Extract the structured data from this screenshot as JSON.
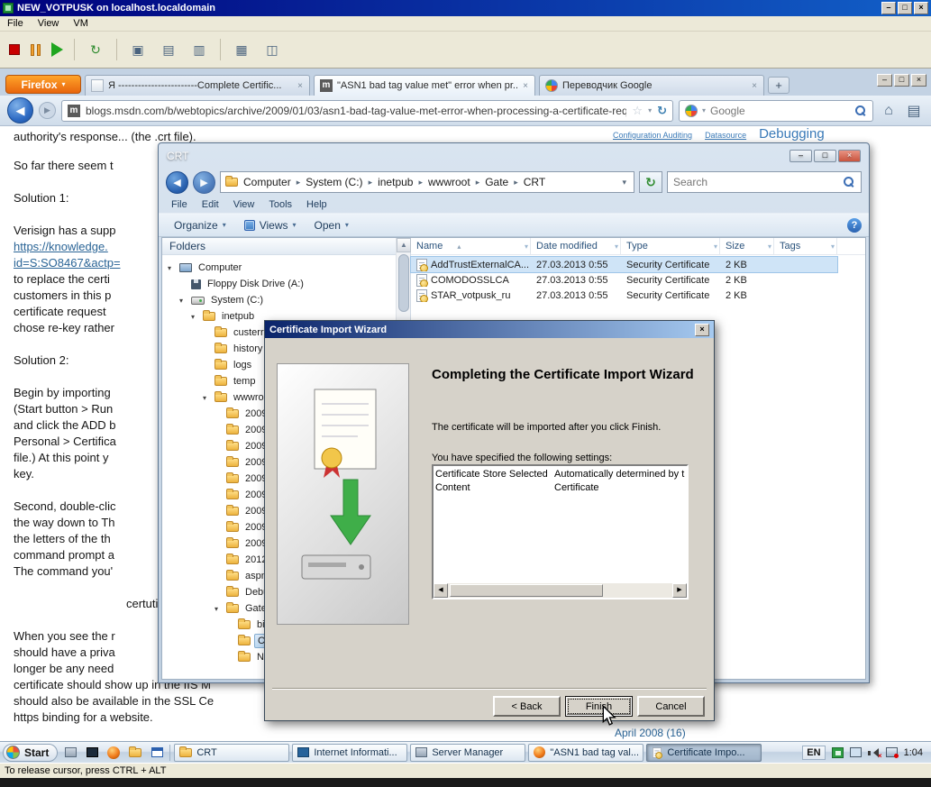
{
  "vm": {
    "title": "NEW_VOTPUSK on localhost.localdomain",
    "menu": [
      "File",
      "View",
      "VM"
    ],
    "status": "To release cursor, press CTRL + ALT"
  },
  "icons": {
    "minimize": "–",
    "maximize": "□",
    "close": "×",
    "back_arrow": "◀",
    "forward_arrow": "▶",
    "dropdown": "▾",
    "reload": "↻",
    "home": "⌂",
    "new_tab": "+"
  },
  "browser": {
    "app_button": "Firefox",
    "tabs": [
      {
        "title": "Я ------------------------Complete Certific...",
        "active": false
      },
      {
        "title": "\"ASN1 bad tag value met\" error when pr...",
        "active": true
      },
      {
        "title": "Переводчик Google",
        "active": false
      }
    ],
    "url": "blogs.msdn.com/b/webtopics/archive/2009/01/03/asn1-bad-tag-value-met-error-when-processing-a-certificate-request-in",
    "search_placeholder": "Google"
  },
  "page": {
    "header_links": [
      "Configuration Auditing",
      "Datasource",
      "Debugging"
    ],
    "paragraphs": [
      {
        "lines": [
          {
            "t": "authority's response...  (the .crt file)."
          }
        ]
      },
      {
        "lines": [
          {
            "t": "So far there seem t"
          }
        ]
      },
      {
        "lines": [
          {
            "t": "Solution 1:"
          }
        ]
      },
      {
        "lines": [
          {
            "t": "Verisign has a supp"
          },
          {
            "t": "https://knowledge.",
            "link": true
          },
          {
            "t": "id=S:SO8467&actp=",
            "link": true
          },
          {
            "t": "to replace the certi"
          },
          {
            "t": "customers in this p"
          },
          {
            "t": "certificate request"
          },
          {
            "t": "chose re-key rather"
          }
        ]
      },
      {
        "lines": [
          {
            "t": "Solution 2:"
          }
        ]
      },
      {
        "lines": [
          {
            "t": "Begin by importing"
          },
          {
            "t": "(Start button > Run"
          },
          {
            "t": "and click the ADD b"
          },
          {
            "t": "Personal > Certifica"
          },
          {
            "t": "file.)  At this point y"
          },
          {
            "t": "key."
          }
        ]
      },
      {
        "lines": [
          {
            "t": "Second, double-clic"
          },
          {
            "t": "the way down to Th"
          },
          {
            "t": "the letters of the th"
          },
          {
            "t": "command prompt a"
          },
          {
            "t": "The command you'"
          }
        ]
      },
      {
        "lines": [
          {
            "t": "certutil",
            "indent": true
          }
        ]
      },
      {
        "lines": [
          {
            "t": "When you see the r"
          },
          {
            "t": "should have a priva"
          },
          {
            "t": "longer be any need"
          },
          {
            "t": "certificate should show up in the IIS M"
          },
          {
            "t": "should also be available in the SSL Ce"
          },
          {
            "t": "https binding for a website."
          }
        ]
      }
    ],
    "archive_link": "April 2008 (16)"
  },
  "explorer": {
    "title": "CRT",
    "breadcrumbs": [
      "Computer",
      "System (C:)",
      "inetpub",
      "wwwroot",
      "Gate",
      "CRT"
    ],
    "search_placeholder": "Search",
    "menu": [
      "File",
      "Edit",
      "View",
      "Tools",
      "Help"
    ],
    "commands": [
      "Organize",
      "Views",
      "Open"
    ],
    "folders_label": "Folders",
    "tree": [
      {
        "label": "Computer",
        "lvl": 0,
        "icon": "computer",
        "exp": true
      },
      {
        "label": "Floppy Disk Drive (A:)",
        "lvl": 1,
        "icon": "floppy"
      },
      {
        "label": "System (C:)",
        "lvl": 1,
        "icon": "drive",
        "exp": true
      },
      {
        "label": "inetpub",
        "lvl": 2,
        "icon": "folder",
        "exp": true
      },
      {
        "label": "custerr",
        "lvl": 3,
        "icon": "folder"
      },
      {
        "label": "history",
        "lvl": 3,
        "icon": "folder"
      },
      {
        "label": "logs",
        "lvl": 3,
        "icon": "folder"
      },
      {
        "label": "temp",
        "lvl": 3,
        "icon": "folder"
      },
      {
        "label": "wwwroot",
        "lvl": 3,
        "icon": "folder",
        "exp": true
      },
      {
        "label": "2009_",
        "lvl": 4,
        "icon": "folder"
      },
      {
        "label": "2009_",
        "lvl": 4,
        "icon": "folder"
      },
      {
        "label": "2009_",
        "lvl": 4,
        "icon": "folder"
      },
      {
        "label": "2009_",
        "lvl": 4,
        "icon": "folder"
      },
      {
        "label": "2009_",
        "lvl": 4,
        "icon": "folder"
      },
      {
        "label": "2009_",
        "lvl": 4,
        "icon": "folder"
      },
      {
        "label": "2009_",
        "lvl": 4,
        "icon": "folder"
      },
      {
        "label": "2009_",
        "lvl": 4,
        "icon": "folder"
      },
      {
        "label": "2009_",
        "lvl": 4,
        "icon": "folder"
      },
      {
        "label": "2012_",
        "lvl": 4,
        "icon": "folder"
      },
      {
        "label": "aspne",
        "lvl": 4,
        "icon": "folder"
      },
      {
        "label": "Debug",
        "lvl": 4,
        "icon": "folder"
      },
      {
        "label": "Gate",
        "lvl": 4,
        "icon": "folder",
        "exp": true
      },
      {
        "label": "bin",
        "lvl": 5,
        "icon": "folder"
      },
      {
        "label": "CRT",
        "lvl": 5,
        "icon": "folder",
        "sel": true
      },
      {
        "label": "NewF",
        "lvl": 5,
        "icon": "folder"
      }
    ],
    "columns": [
      "Name",
      "Date modified",
      "Type",
      "Size",
      "Tags"
    ],
    "files": [
      {
        "name": "AddTrustExternalCA...",
        "date": "27.03.2013 0:55",
        "type": "Security Certificate",
        "size": "2 KB",
        "selected": true
      },
      {
        "name": "COMODOSSLCA",
        "date": "27.03.2013 0:55",
        "type": "Security Certificate",
        "size": "2 KB"
      },
      {
        "name": "STAR_votpusk_ru",
        "date": "27.03.2013 0:55",
        "type": "Security Certificate",
        "size": "2 KB"
      }
    ]
  },
  "wizard": {
    "title": "Certificate Import Wizard",
    "heading": "Completing the Certificate Import Wizard",
    "description": "The certificate will be imported after you click Finish.",
    "settings_label": "You have specified the following settings:",
    "settings": [
      {
        "name": "Certificate Store Selected",
        "value": "Automatically determined by t"
      },
      {
        "name": "Content",
        "value": "Certificate"
      }
    ],
    "back_label": "< Back",
    "finish_label": "Finish",
    "cancel_label": "Cancel"
  },
  "taskbar": {
    "start_label": "Start",
    "tasks": [
      {
        "label": "CRT",
        "icon": "folder"
      },
      {
        "label": "Internet Informati...",
        "icon": "iis"
      },
      {
        "label": "Server Manager",
        "icon": "server"
      },
      {
        "label": "\"ASN1 bad tag val...",
        "icon": "firefox"
      },
      {
        "label": "Certificate Impo...",
        "icon": "wizard",
        "active": true
      }
    ],
    "language": "EN",
    "clock": "1:04"
  }
}
